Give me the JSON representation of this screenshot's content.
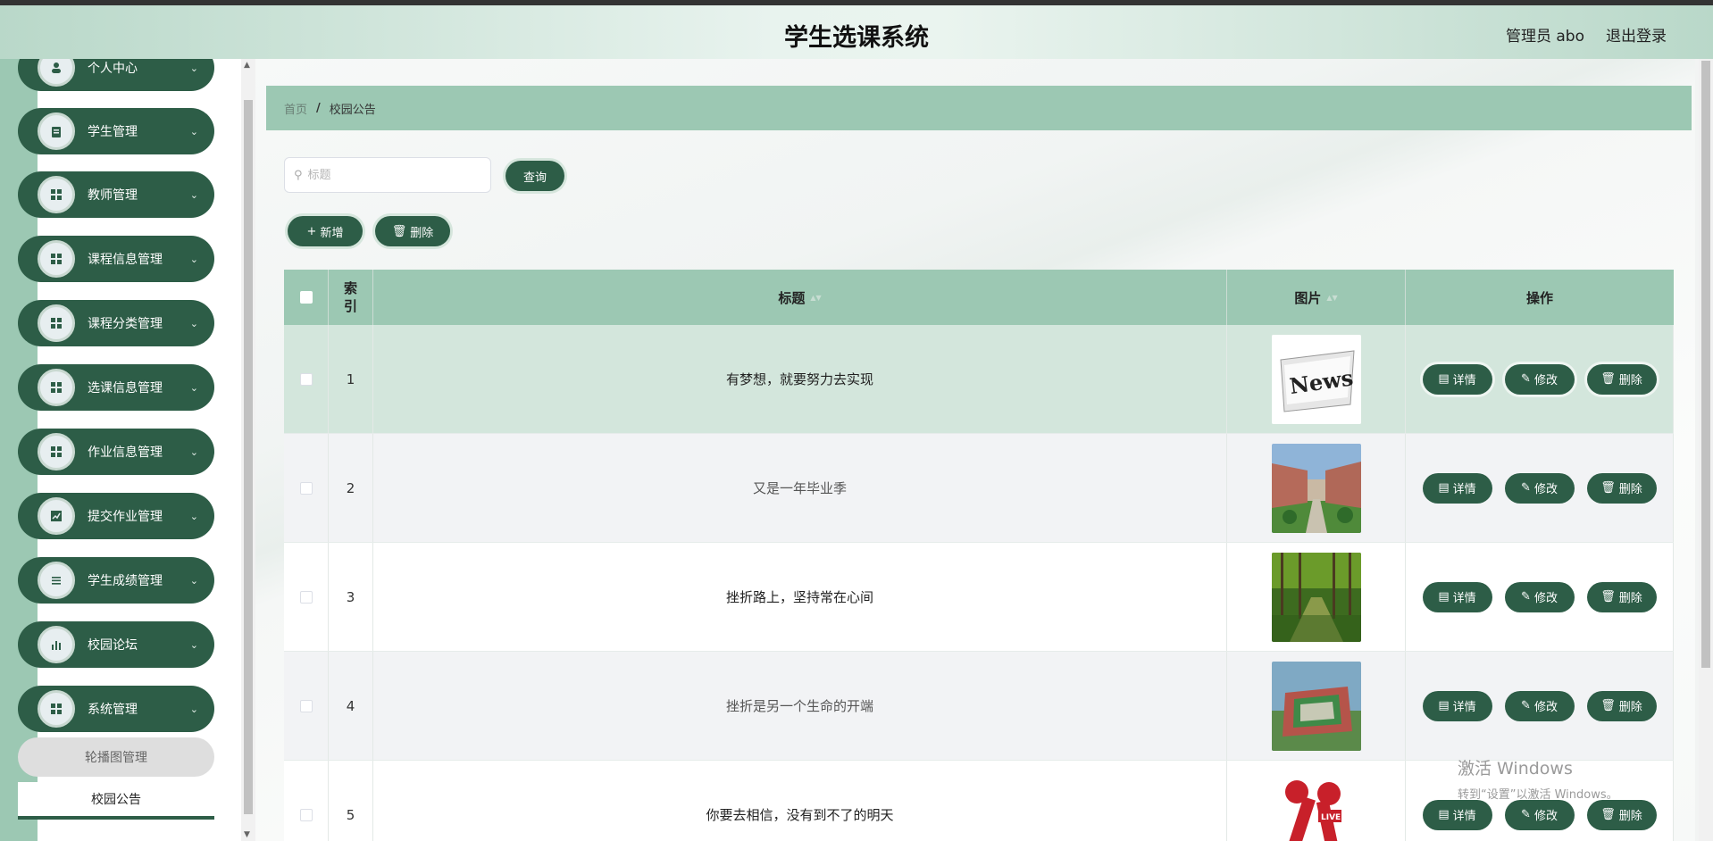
{
  "app": {
    "title": "学生选课系统"
  },
  "header": {
    "user_label": "管理员 abo",
    "logout_label": "退出登录"
  },
  "sidebar": {
    "items": [
      {
        "label": "个人中心",
        "icon": "person-icon"
      },
      {
        "label": "学生管理",
        "icon": "clipboard-icon"
      },
      {
        "label": "教师管理",
        "icon": "grid-icon"
      },
      {
        "label": "课程信息管理",
        "icon": "grid-icon"
      },
      {
        "label": "课程分类管理",
        "icon": "grid-icon"
      },
      {
        "label": "选课信息管理",
        "icon": "grid-icon"
      },
      {
        "label": "作业信息管理",
        "icon": "grid-icon"
      },
      {
        "label": "提交作业管理",
        "icon": "chart-icon"
      },
      {
        "label": "学生成绩管理",
        "icon": "list-icon"
      },
      {
        "label": "校园论坛",
        "icon": "bar-chart-icon"
      },
      {
        "label": "系统管理",
        "icon": "grid-icon"
      }
    ],
    "subitems": [
      {
        "label": "轮播图管理"
      },
      {
        "label": "校园公告",
        "active": true
      }
    ]
  },
  "breadcrumb": {
    "home": "首页",
    "separator": "/",
    "current": "校园公告"
  },
  "search": {
    "placeholder": "标题",
    "value": ""
  },
  "toolbar": {
    "query_label": "查询",
    "add_label": "新增",
    "delete_label": "删除"
  },
  "table": {
    "columns": {
      "index": "索引",
      "title": "标题",
      "image": "图片",
      "ops": "操作"
    },
    "rows": [
      {
        "index": "1",
        "title": "有梦想，就要努力去实现",
        "image": "news-image"
      },
      {
        "index": "2",
        "title": "又是一年毕业季",
        "image": "campus-building-image"
      },
      {
        "index": "3",
        "title": "挫折路上，坚持常在心间",
        "image": "forest-road-image"
      },
      {
        "index": "4",
        "title": "挫折是另一个生命的开端",
        "image": "stadium-aerial-image"
      },
      {
        "index": "5",
        "title": "你要去相信，没有到不了的明天",
        "image": "news-microphone-image"
      }
    ],
    "op_labels": {
      "detail": "详情",
      "edit": "修改",
      "delete": "删除"
    },
    "news_text": "News",
    "live_text": "LIVE"
  },
  "watermark": {
    "line1": "激活 Windows",
    "line2": "转到“设置”以激活 Windows。"
  },
  "colors": {
    "accent": "#2d5d47",
    "header_bg": "#9cc8b3",
    "row_highlight": "#d3e6dc"
  }
}
